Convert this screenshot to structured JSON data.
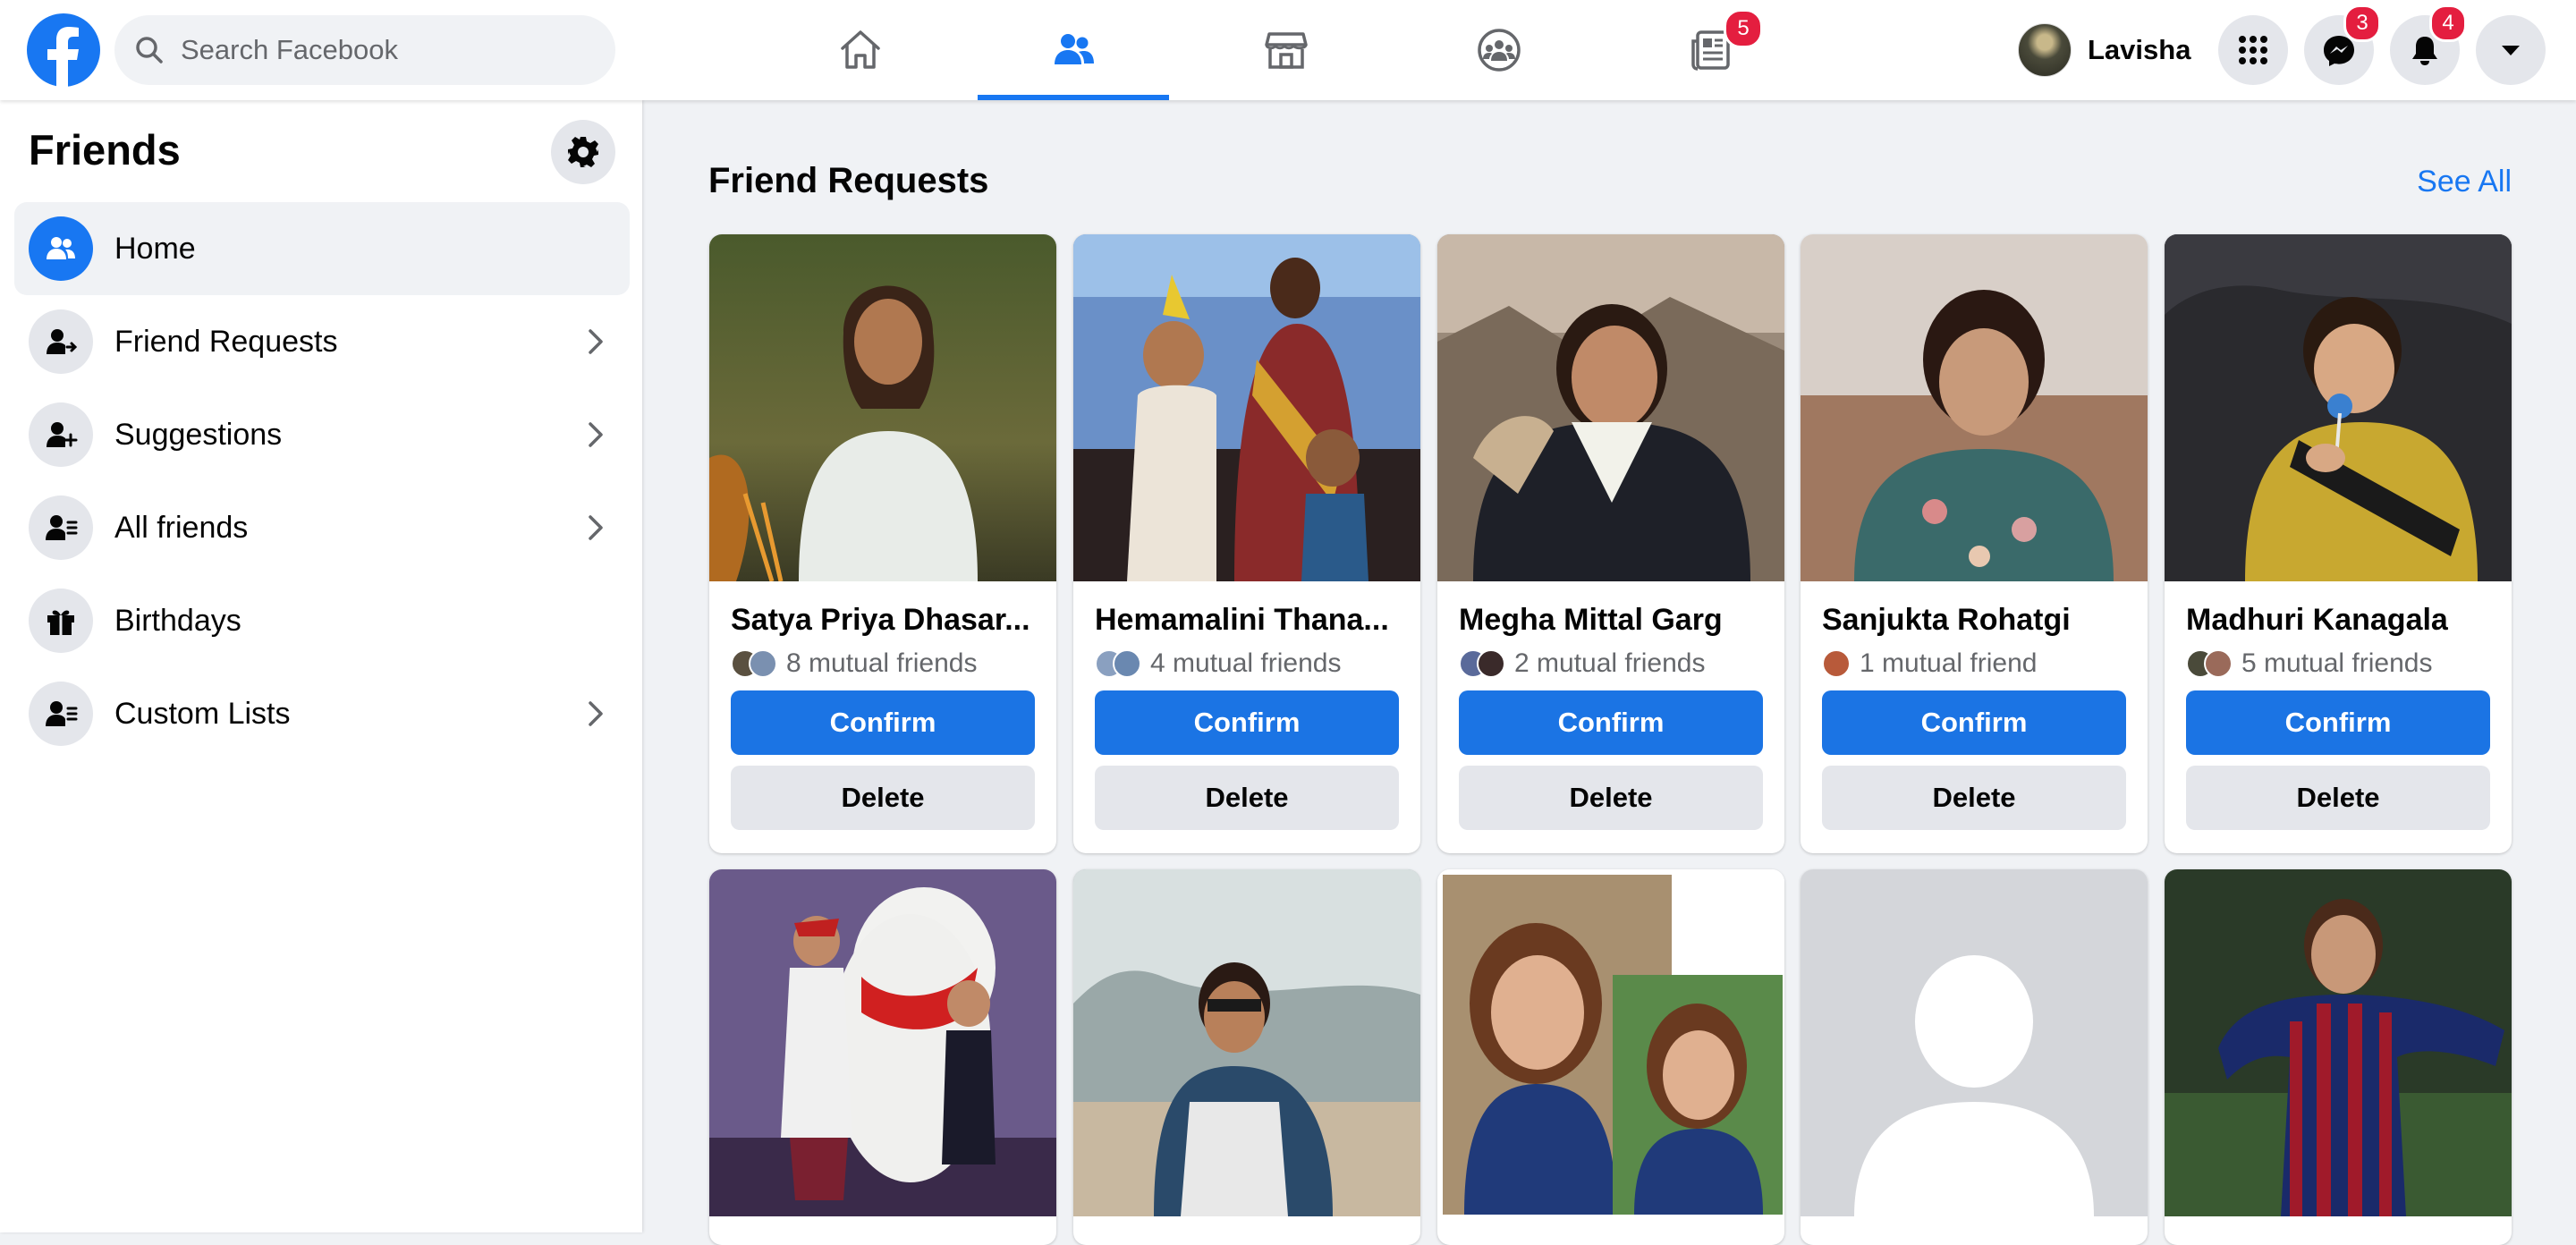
{
  "brand": {
    "color": "#1877f2",
    "badge_color": "#e41e3f"
  },
  "header": {
    "search_placeholder": "Search Facebook",
    "nav": [
      {
        "name": "home",
        "icon": "home-icon",
        "active": false
      },
      {
        "name": "friends",
        "icon": "friends-icon",
        "active": true
      },
      {
        "name": "marketplace",
        "icon": "marketplace-icon",
        "active": false
      },
      {
        "name": "groups",
        "icon": "groups-icon",
        "active": false
      },
      {
        "name": "news",
        "icon": "news-icon",
        "active": false,
        "badge": "5"
      }
    ],
    "profile_name": "Lavisha",
    "menu_icon": "grid-menu-icon",
    "messenger_badge": "3",
    "notifications_badge": "4",
    "account_icon": "caret-down-icon"
  },
  "sidebar": {
    "title": "Friends",
    "settings_icon": "gear-icon",
    "items": [
      {
        "label": "Home",
        "icon": "friends-home-icon",
        "active": true,
        "chevron": false
      },
      {
        "label": "Friend Requests",
        "icon": "person-arrow-icon",
        "active": false,
        "chevron": true
      },
      {
        "label": "Suggestions",
        "icon": "person-plus-icon",
        "active": false,
        "chevron": true
      },
      {
        "label": "All friends",
        "icon": "person-list-icon",
        "active": false,
        "chevron": true
      },
      {
        "label": "Birthdays",
        "icon": "gift-icon",
        "active": false,
        "chevron": false
      },
      {
        "label": "Custom Lists",
        "icon": "person-list-icon",
        "active": false,
        "chevron": true
      }
    ]
  },
  "main": {
    "section_title": "Friend Requests",
    "see_all": "See All",
    "confirm_label": "Confirm",
    "delete_label": "Delete",
    "requests": [
      {
        "name": "Satya Priya Dhasar...",
        "mutual": "8 mutual friends"
      },
      {
        "name": "Hemamalini Thana...",
        "mutual": "4 mutual friends"
      },
      {
        "name": "Megha Mittal Garg",
        "mutual": "2 mutual friends"
      },
      {
        "name": "Sanjukta Rohatgi",
        "mutual": "1 mutual friend"
      },
      {
        "name": "Madhuri Kanagala",
        "mutual": "5 mutual friends"
      }
    ]
  }
}
